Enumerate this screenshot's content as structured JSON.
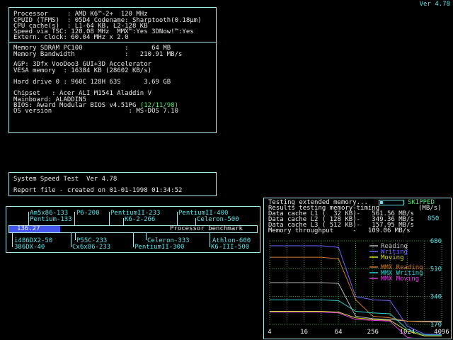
{
  "version": "Ver 4.78",
  "sysinfo": {
    "cpu": [
      "Processor     : AMD K6™-2+  120 MHz",
      "CPUID (TFMS)  : 05D4 Codename: Sharptooth(0.18µm)",
      "CPU cache(s)  : L1-64 KB, L2-128 KB",
      "Speed via TSC: 120.08 MHz  MMX™:Yes 3DNow!™:Yes",
      "Extern. clock: 60.04 MHz x 2.0"
    ],
    "memory": [
      "Memory SDRAM PC100           :      64 MB",
      "Memory Bandwidth             :   210.91 MB/s"
    ],
    "video": [
      "AGP: 3Dfx VooDoo3 GUI+3D Accelerator",
      "VESA memory  : 16384 KB (28602 KB/s)"
    ],
    "hdd": "Hard drive 0 : 960C 128H 63S      3.69 GB",
    "chipset": "Chipset   : Acer ALI M1541 Aladdin V",
    "mainboard": "Mainboard: ALADDIN5",
    "bios": "BIOS: Award Modular BIOS v4.51PG ",
    "bios_date": "(12/11/98)",
    "os": "OS version                    : MS-DOS 7.10"
  },
  "speedtest": {
    "title": "System Speed Test  Ver 4.78",
    "report": "Report file - created on 01-01-1998 01:34:52"
  },
  "benchmark": {
    "value": "136.27",
    "fraction": 0.205,
    "label": "Processor benchmark",
    "top_row1": [
      "Am5x86-133",
      "P6-200",
      "PentiumII-233",
      "PentiumII-400"
    ],
    "top_row2": [
      "Pentium-133",
      "K6-2-266",
      "Celeron-500"
    ],
    "bot_row1": [
      "i486DX2-50",
      "P55C-233",
      "Celeron-333",
      "Athlon-600"
    ],
    "bot_row2": [
      "386DX-40",
      "Cx6x86-233",
      "PentiumII-300",
      "K6-III-500"
    ]
  },
  "memtest": {
    "testing": "Testing extended memory...",
    "skipped": "SKIPPED",
    "results": "Results testing memory-timing",
    "unit": "(MB/s)",
    "rows": [
      "Data cache L1 (  32 KB)-   561.56 MB/s",
      "Data cache L2 ( 128 KB)-   349.36 MB/s",
      "Data cache L3 ( 512 KB)-   157.95 MB/s",
      "Memory throughput     -   109.06 MB/s"
    ],
    "y_850": "850"
  },
  "chart_data": {
    "type": "line",
    "x_log2": true,
    "x_tick_labels": [
      "4",
      "16",
      "64",
      "256",
      "1024",
      "4096"
    ],
    "x": [
      4,
      8,
      16,
      32,
      64,
      128,
      256,
      512,
      1024,
      2048,
      4096
    ],
    "y_tick_labels": [
      "680",
      "510",
      "340",
      "170"
    ],
    "ylim": [
      0,
      850
    ],
    "grid": true,
    "legend_position": "inside-upper-right",
    "colors": {
      "Reading": "#b8b8b8",
      "Writing": "#6868ff",
      "Moving": "#d8d830",
      "MMX Reading": "#cf7a2c",
      "MMX Writing": "#34d0d0",
      "MMX Moving": "#e040e0",
      "grid": "#3aa03a",
      "tick": "#5ee0e8"
    },
    "series": [
      {
        "name": "Reading",
        "values": [
          425,
          425,
          425,
          425,
          420,
          220,
          205,
          200,
          190,
          190,
          190
        ]
      },
      {
        "name": "Writing",
        "values": [
          650,
          650,
          650,
          650,
          640,
          340,
          320,
          315,
          160,
          110,
          110
        ]
      },
      {
        "name": "Moving",
        "values": [
          250,
          250,
          250,
          250,
          245,
          210,
          200,
          195,
          130,
          100,
          100
        ]
      },
      {
        "name": "MMX Reading",
        "values": [
          580,
          580,
          580,
          580,
          570,
          320,
          220,
          210,
          190,
          185,
          185
        ]
      },
      {
        "name": "MMX Writing",
        "values": [
          320,
          320,
          320,
          320,
          315,
          250,
          240,
          235,
          140,
          105,
          105
        ]
      },
      {
        "name": "MMX Moving",
        "values": [
          245,
          245,
          245,
          245,
          240,
          200,
          195,
          190,
          90,
          80,
          80
        ]
      }
    ]
  }
}
